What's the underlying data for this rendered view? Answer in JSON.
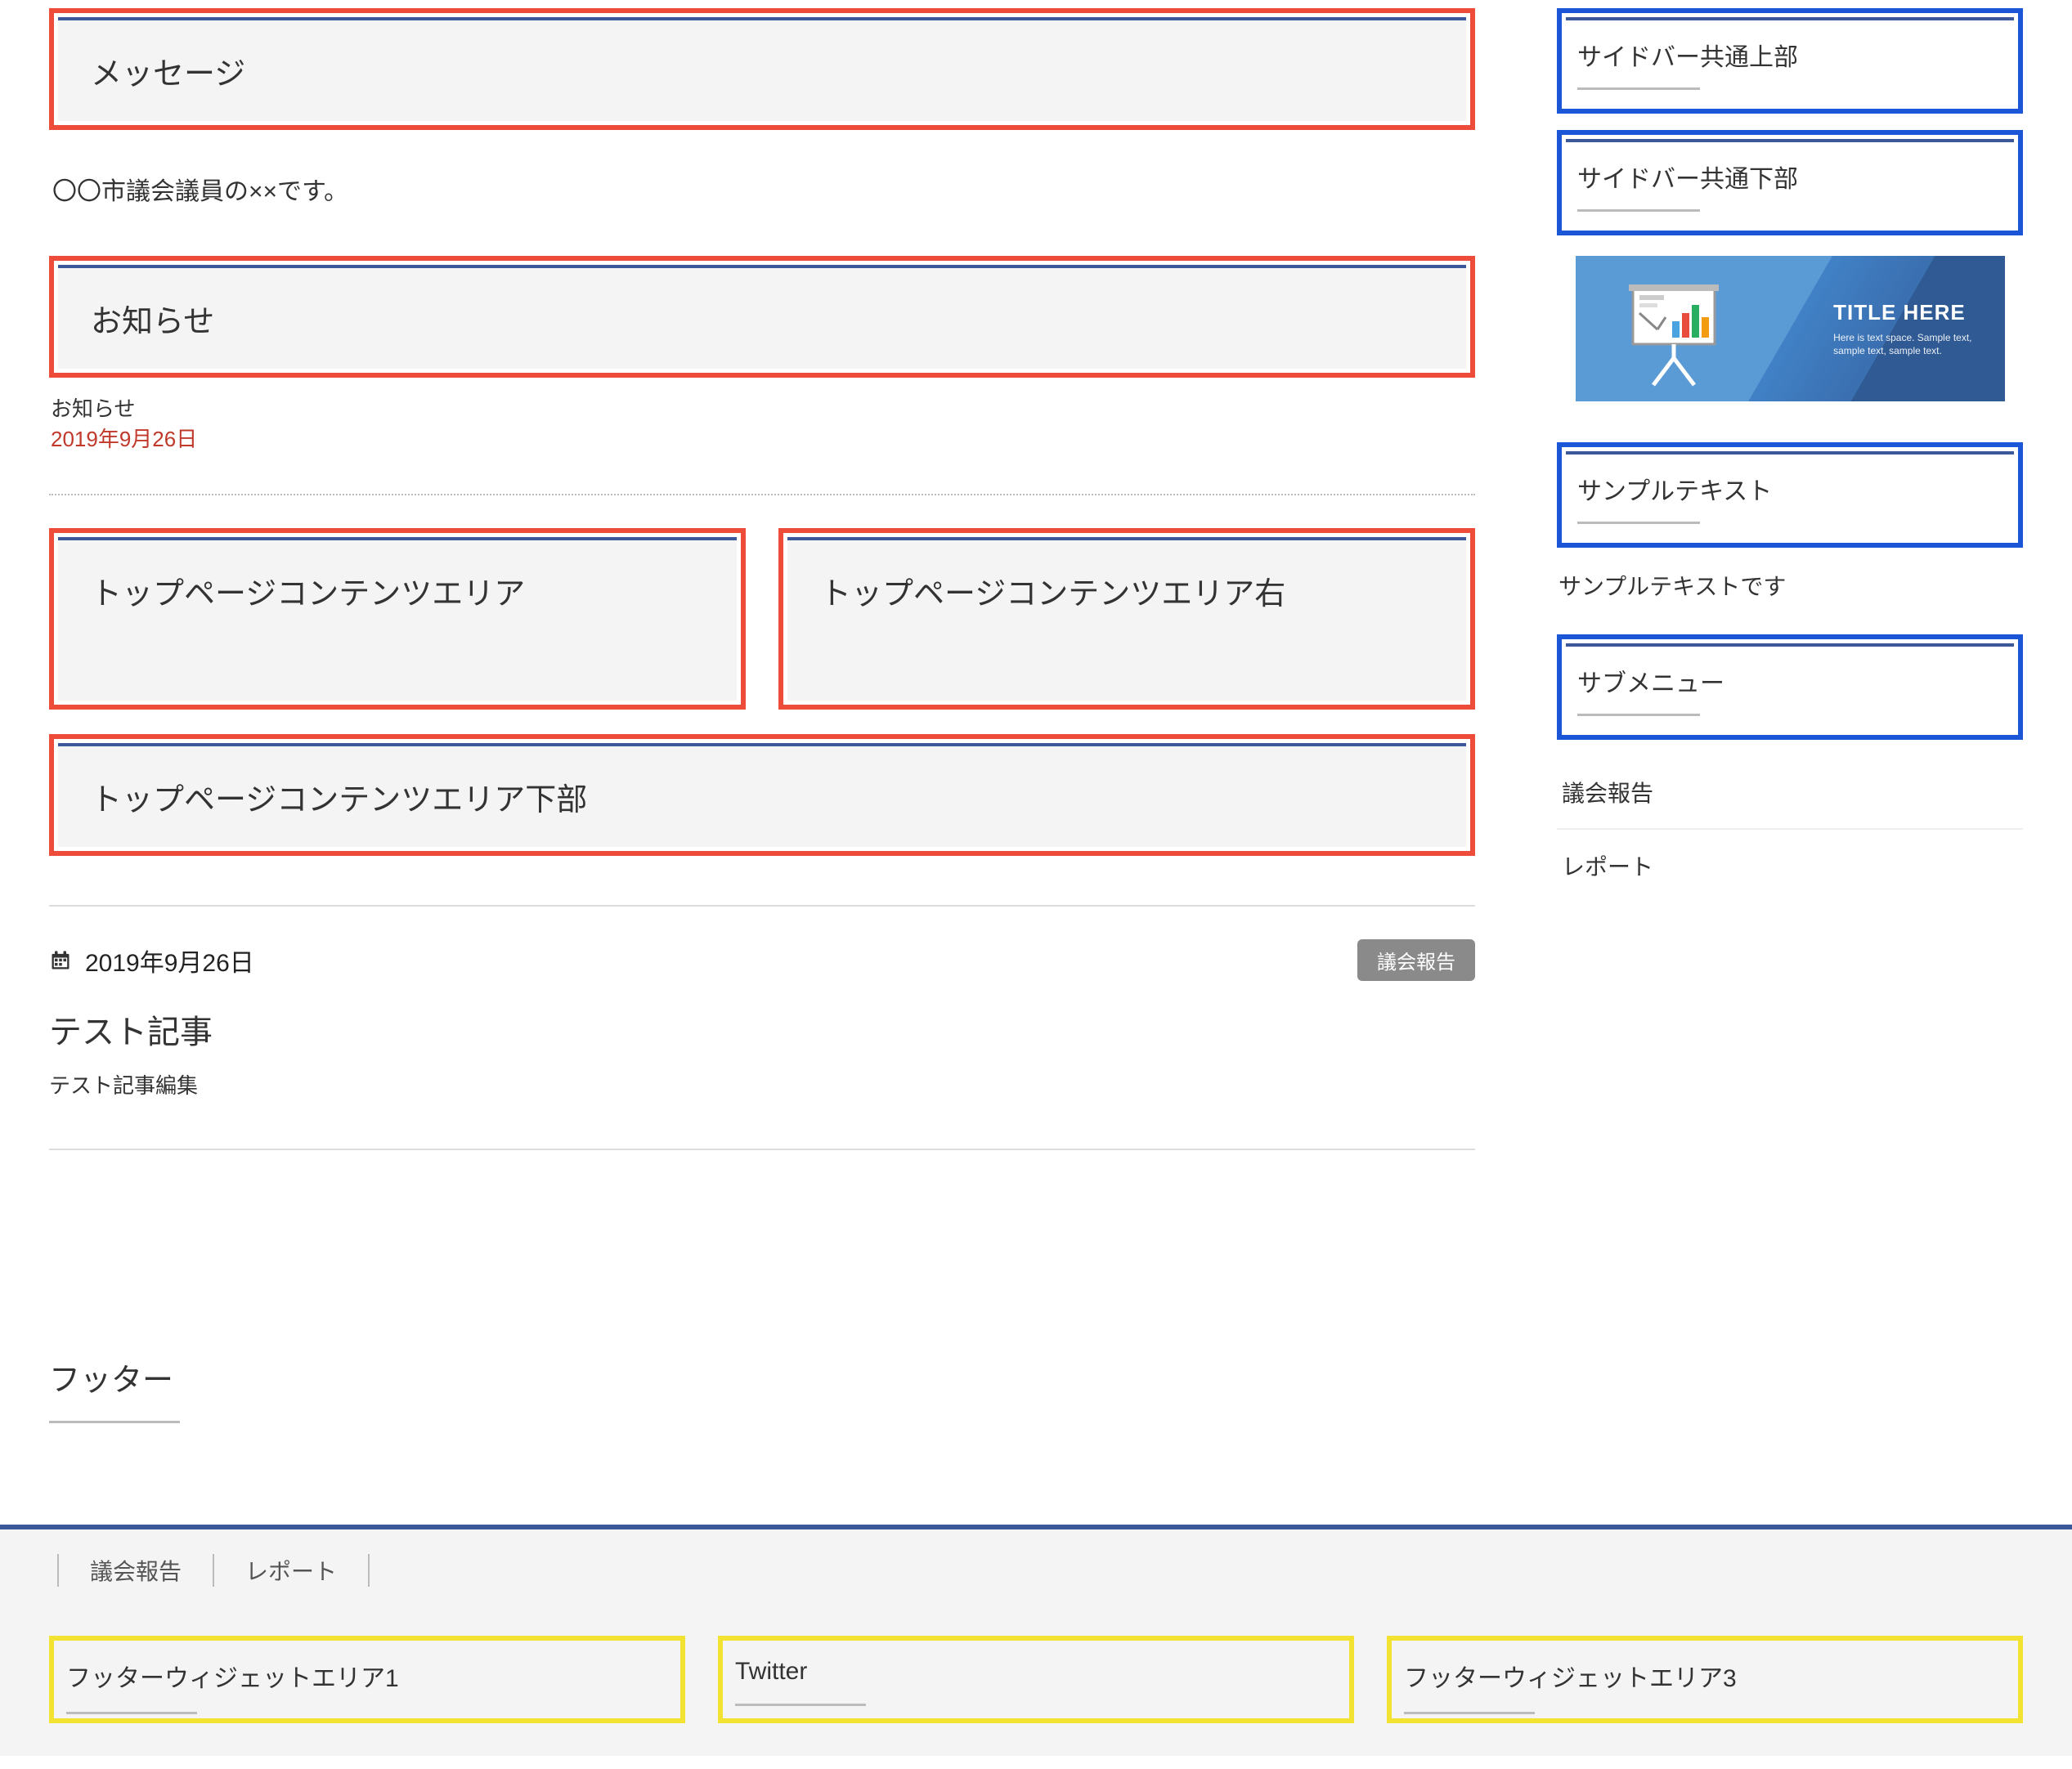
{
  "main": {
    "message_heading": "メッセージ",
    "intro_text": "〇〇市議会議員の××です。",
    "news_heading": "お知らせ",
    "news_label": "お知らせ",
    "news_date": "2019年9月26日",
    "top_left_heading": "トップページコンテンツエリア",
    "top_right_heading": "トップページコンテンツエリア右",
    "top_bottom_heading": "トップページコンテンツエリア下部",
    "post": {
      "date": "2019年9月26日",
      "category": "議会報告",
      "title": "テスト記事",
      "excerpt": "テスト記事編集"
    }
  },
  "sidebar": {
    "top_heading": "サイドバー共通上部",
    "bottom_heading": "サイドバー共通下部",
    "banner": {
      "title": "TITLE HERE",
      "subtitle1": "Here is text space. Sample text,",
      "subtitle2": "sample text, sample text."
    },
    "sample_heading": "サンプルテキスト",
    "sample_text": "サンプルテキストです",
    "submenu_heading": "サブメニュー",
    "submenu_items": [
      "議会報告",
      "レポート"
    ]
  },
  "footer": {
    "heading": "フッター",
    "nav": [
      "議会報告",
      "レポート"
    ],
    "widgets": [
      "フッターウィジェットエリア1",
      "Twitter",
      "フッターウィジェットエリア3"
    ]
  }
}
